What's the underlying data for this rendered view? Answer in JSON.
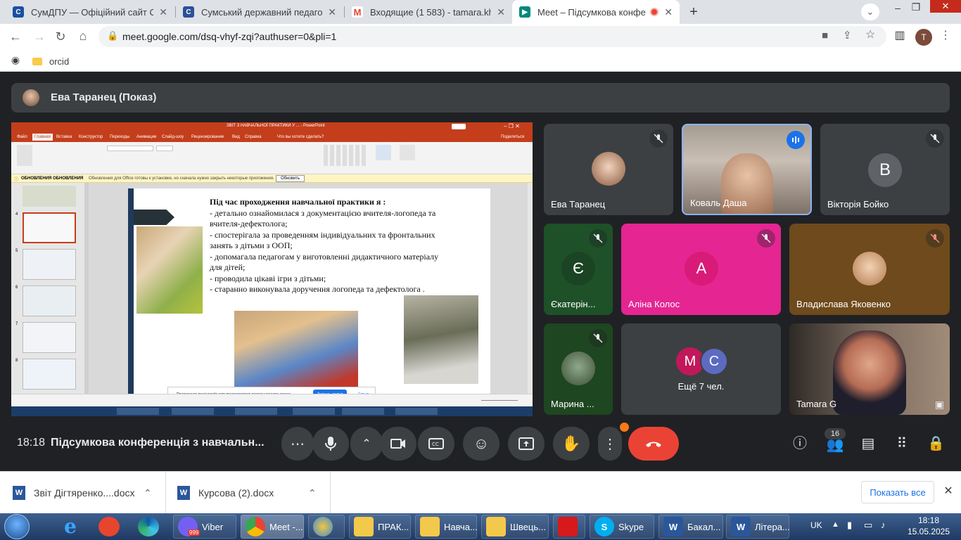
{
  "tabs": [
    {
      "title": "СумДПУ — Офіційний сайт Сум",
      "color": "#1a4fa3"
    },
    {
      "title": "Сумський державний педагогіч",
      "color": "#2b4f9a"
    },
    {
      "title": "Входящие (1 583) - tamara.kharc",
      "color": "#ea4335"
    },
    {
      "title": "Meet – Підсумкова конфере",
      "color": "#00897b"
    }
  ],
  "address": "meet.google.com/dsq-vhyf-zqi?authuser=0&pli=1",
  "profile_initial": "T",
  "bookmark": "orcid",
  "presenter": "Ева Таранец (Показ)",
  "ppt": {
    "title": "ЗВІТ З НАВЧАЛЬНОЇ ПРАКТИКИ У ... - PowerPoint",
    "tabs": [
      "Файл",
      "Главная",
      "Вставка",
      "Конструктор",
      "Переходы",
      "Анимации",
      "Слайд-шоу",
      "Рецензирование",
      "Вид",
      "Справка",
      "Что вы хотите сделать?",
      "Поделиться"
    ],
    "update_title": "ОБНОВЛЕНИЯ ОБНОВЛЕНИЯ",
    "update_text": "Обновления для Office готовы к установке, но сначала нужно закрыть некоторые приложения.",
    "update_button": "Обновить",
    "thumb_numbers": [
      "4",
      "5",
      "6",
      "7",
      "8"
    ],
    "share_notice": "Приложение meet.google.com предоставляет доступ к вашему экрану.",
    "stop_share": "Закрыть доступ",
    "hide": "Скрыть"
  },
  "slide": {
    "heading": "Під час проходження навчальної практики я :",
    "lines": [
      "- детально ознайомилася з документацією вчителя-логопеда та",
      "вчителя-дефектолога;",
      "- спостерігала за проведенням індивідуальних та фронтальних",
      "занять з дітьми з ООП;",
      "- допомагала педагогам у виготовленні дидактичного матеріалу",
      "для дітей;",
      "- проводила цікаві ігри з дітьми;",
      "- старанно виконувала доручення логопеда та дефектолога ."
    ]
  },
  "participants": [
    {
      "name": "Ева Таранец",
      "initial": ""
    },
    {
      "name": "Коваль Даша",
      "initial": ""
    },
    {
      "name": "Вікторія Бойко",
      "initial": "В"
    },
    {
      "name": "Єкатерін...",
      "initial": "Є"
    },
    {
      "name": "Аліна Колос",
      "initial": "А"
    },
    {
      "name": "Владислава Яковенко",
      "initial": ""
    },
    {
      "name": "Марина ...",
      "initial": ""
    },
    {
      "name": "Ещё 7 чел.",
      "initial": ""
    },
    {
      "name": "Tamara G",
      "initial": ""
    }
  ],
  "more_avatars": [
    "М",
    "С"
  ],
  "meeting": {
    "time": "18:18",
    "title": "Підсумкова конференція з навчальн...",
    "people_count": "16"
  },
  "downloads": [
    {
      "name": "Звіт Дігтяренко....docx"
    },
    {
      "name": "Курсова (2).docx"
    }
  ],
  "show_all": "Показать все",
  "taskbar": {
    "items": [
      "Viber",
      "Meet -...",
      "",
      "ПРАК...",
      "Навча...",
      "Швець...",
      "",
      "Skype",
      "Бакал...",
      "Літера..."
    ],
    "viber_badge": "999",
    "lang": "UK",
    "time": "18:18",
    "date": "15.05.2025"
  },
  "colors": {
    "meet_bg": "#202124",
    "tile": "#3c4043",
    "red": "#ea4335",
    "ppt_red": "#c43e1c",
    "aline_pink": "#e52592",
    "viktoria_teal": "#5f6368",
    "ekaterina_green": "#1e5128"
  }
}
